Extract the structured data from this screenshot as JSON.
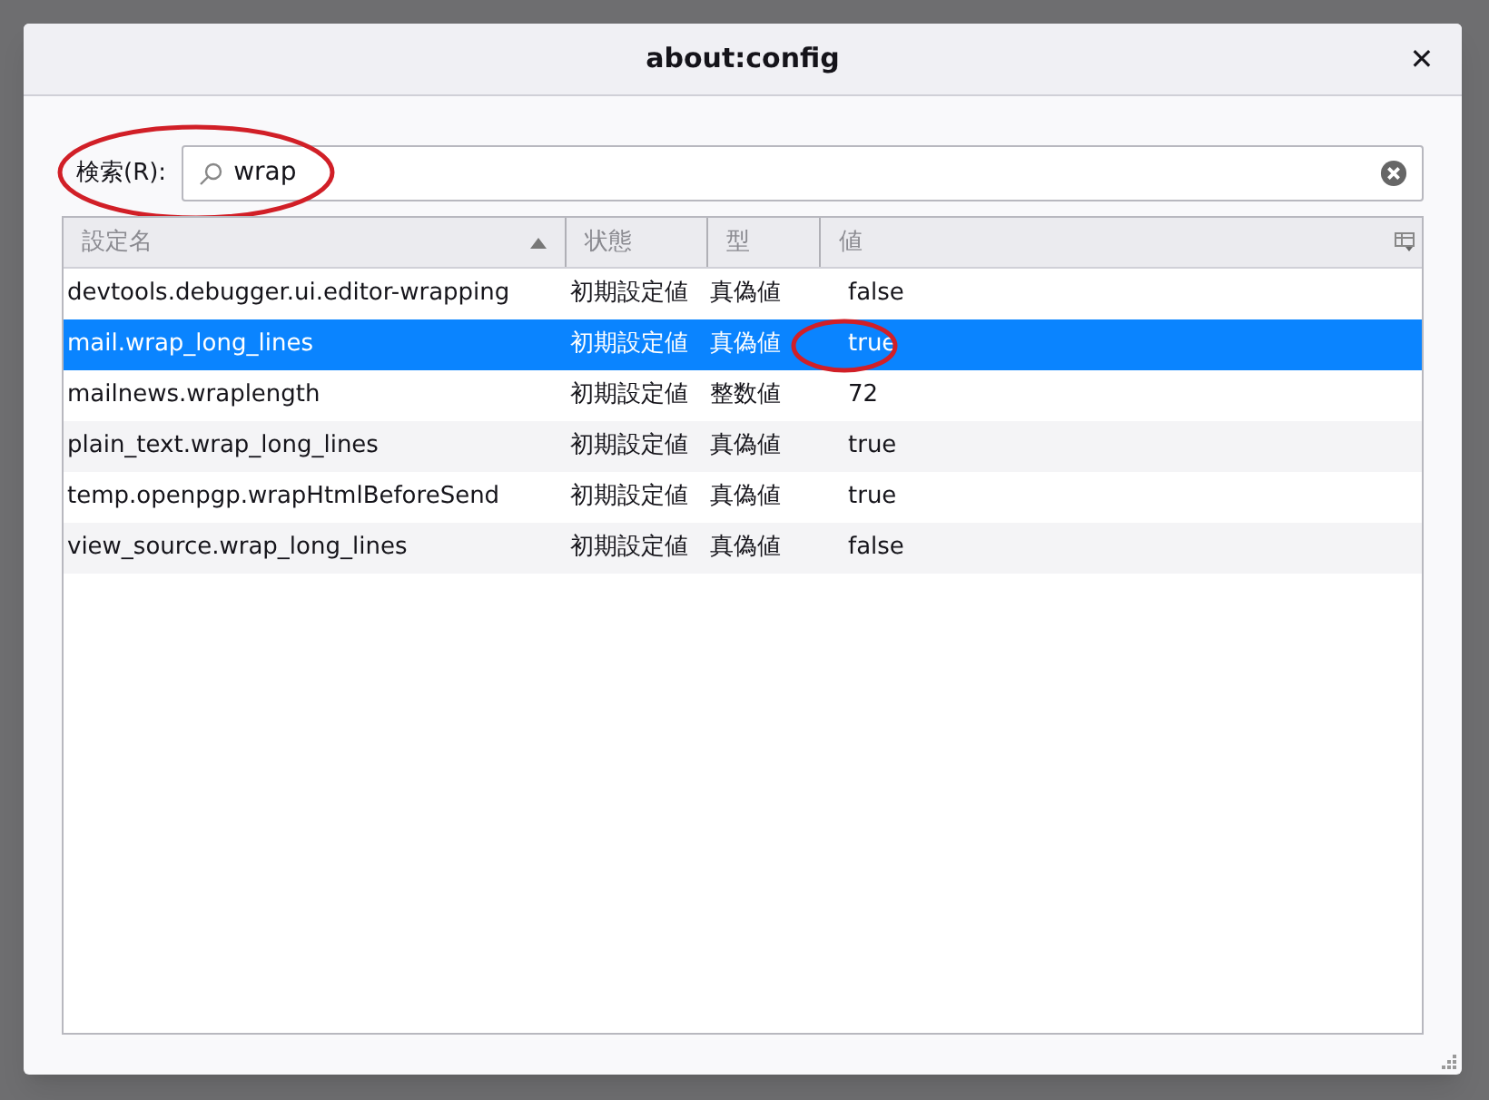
{
  "window": {
    "title": "about:config",
    "close": "✕"
  },
  "search": {
    "label": "検索(R):",
    "value": "wrap",
    "circled": true
  },
  "table": {
    "columns": [
      {
        "label": "設定名",
        "sorted": true
      },
      {
        "label": "状態",
        "sorted": false
      },
      {
        "label": "型",
        "sorted": false
      },
      {
        "label": "値",
        "sorted": false
      }
    ],
    "rows": [
      {
        "name": "devtools.debugger.ui.editor-wrapping",
        "status": "初期設定値",
        "type": "真偽値",
        "value": "false",
        "selected": false,
        "circled": false
      },
      {
        "name": "mail.wrap_long_lines",
        "status": "初期設定値",
        "type": "真偽値",
        "value": "true",
        "selected": true,
        "circled": true
      },
      {
        "name": "mailnews.wraplength",
        "status": "初期設定値",
        "type": "整数値",
        "value": "72",
        "selected": false,
        "circled": false
      },
      {
        "name": "plain_text.wrap_long_lines",
        "status": "初期設定値",
        "type": "真偽値",
        "value": "true",
        "selected": false,
        "circled": false
      },
      {
        "name": "temp.openpgp.wrapHtmlBeforeSend",
        "status": "初期設定値",
        "type": "真偽値",
        "value": "true",
        "selected": false,
        "circled": false
      },
      {
        "name": "view_source.wrap_long_lines",
        "status": "初期設定値",
        "type": "真偽値",
        "value": "false",
        "selected": false,
        "circled": false
      }
    ]
  }
}
